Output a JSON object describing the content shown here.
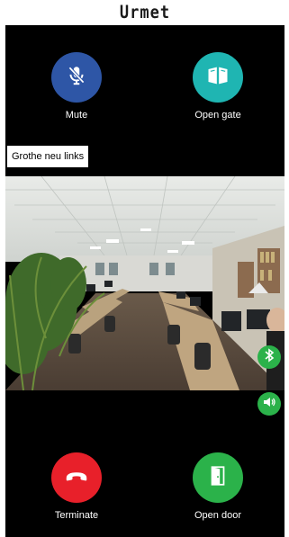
{
  "header": {
    "brand": "Urmet"
  },
  "actions": {
    "mute": {
      "label": "Mute",
      "icon": "mic-off-icon",
      "color": "#2e56a6"
    },
    "open_gate": {
      "label": "Open gate",
      "icon": "gate-icon",
      "color": "#1fb5b2"
    },
    "terminate": {
      "label": "Terminate",
      "icon": "hang-up-icon",
      "color": "#e8202a"
    },
    "open_door": {
      "label": "Open door",
      "icon": "door-icon",
      "color": "#2bb24a"
    }
  },
  "video": {
    "caption": "Grothe neu links",
    "controls": {
      "menu": {
        "icon": "more-vertical-icon"
      },
      "bluetooth": {
        "icon": "bluetooth-icon",
        "color": "#2bb24a"
      },
      "speaker": {
        "icon": "speaker-icon",
        "color": "#2bb24a"
      }
    }
  }
}
